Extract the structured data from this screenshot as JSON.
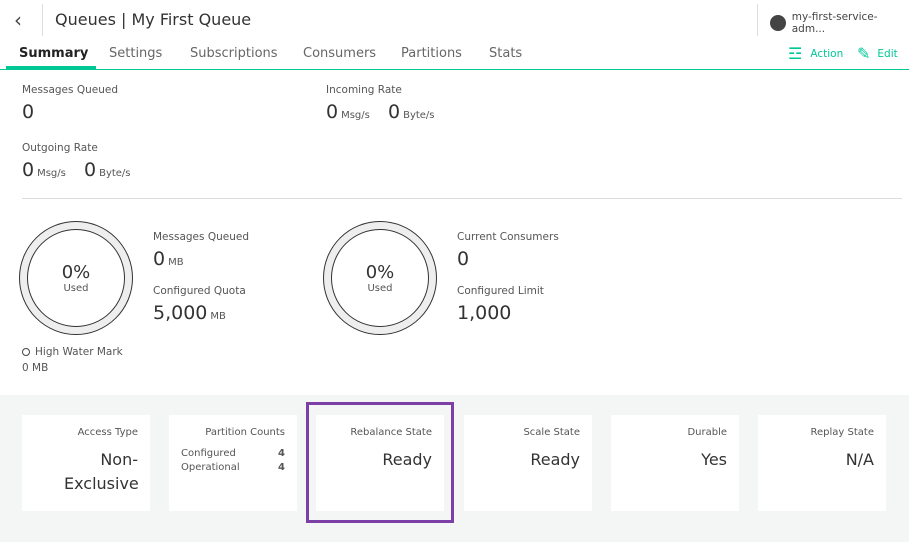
{
  "header": {
    "title": "Queues | My First Queue",
    "user": "my-first-service-adm..."
  },
  "tabs": [
    "Summary",
    "Settings",
    "Subscriptions",
    "Consumers",
    "Partitions",
    "Stats"
  ],
  "actions": {
    "action": "Action",
    "edit": "Edit"
  },
  "rates": {
    "messages_queued": {
      "label": "Messages Queued",
      "value": "0"
    },
    "incoming": {
      "label": "Incoming Rate",
      "msg": "0",
      "msg_unit": "Msg/s",
      "byte": "0",
      "byte_unit": "Byte/s"
    },
    "outgoing": {
      "label": "Outgoing Rate",
      "msg": "0",
      "msg_unit": "Msg/s",
      "byte": "0",
      "byte_unit": "Byte/s"
    }
  },
  "storage": {
    "percent": "0%",
    "used": "Used",
    "mq_label": "Messages Queued",
    "mq_value": "0",
    "mq_unit": "MB",
    "quota_label": "Configured Quota",
    "quota_value": "5,000",
    "quota_unit": "MB",
    "hwm_label": "High Water Mark",
    "hwm_value": "0 MB"
  },
  "consumers": {
    "percent": "0%",
    "used": "Used",
    "cur_label": "Current Consumers",
    "cur_value": "0",
    "limit_label": "Configured Limit",
    "limit_value": "1,000"
  },
  "cards": {
    "access": {
      "title": "Access Type",
      "value": "Non-Exclusive"
    },
    "partitions": {
      "title": "Partition Counts",
      "configured_label": "Configured",
      "configured": "4",
      "operational_label": "Operational",
      "operational": "4"
    },
    "rebalance": {
      "title": "Rebalance State",
      "value": "Ready"
    },
    "scale": {
      "title": "Scale State",
      "value": "Ready"
    },
    "durable": {
      "title": "Durable",
      "value": "Yes"
    },
    "replay": {
      "title": "Replay State",
      "value": "N/A"
    }
  },
  "colors": {
    "accent": "#00c895",
    "highlight": "#7b3fa6"
  }
}
